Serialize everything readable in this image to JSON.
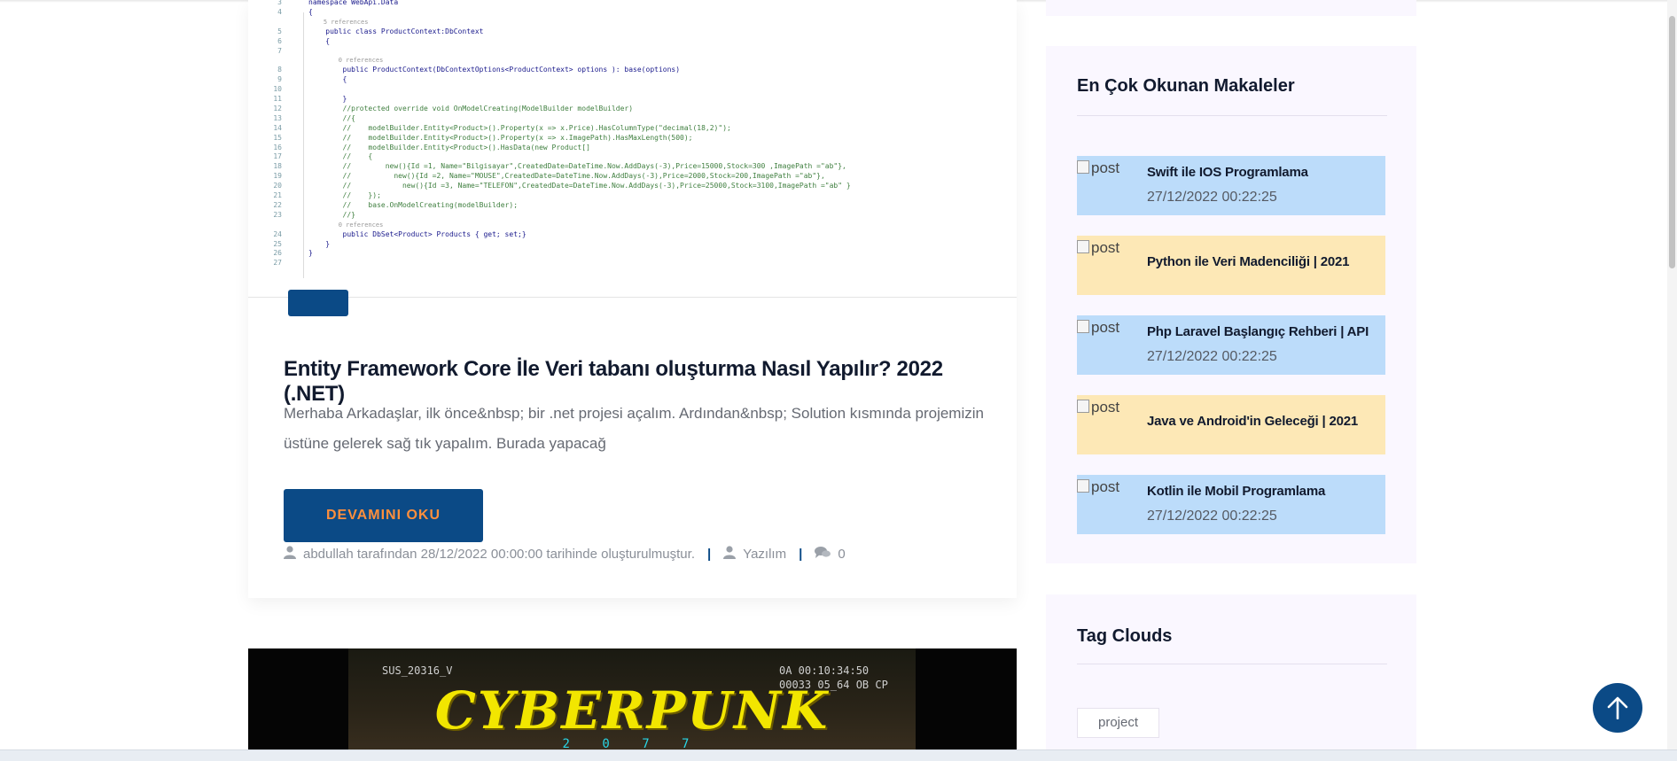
{
  "post": {
    "title": "Entity Framework Core İle Veri tabanı oluşturma Nasıl Yapılır? 2022 (.NET)",
    "excerpt": "Merhaba Arkadaşlar, ilk önce&nbsp; bir .net projesi açalım. Ardından&nbsp; Solution kısmında projemizin üstüne gelerek sağ tık yapalım. Burada yapacağ",
    "read_more_label": "DEVAMINI OKU",
    "author_text": "abdullah tarafından 28/12/2022 00:00:00 tarihinde oluşturulmuştur.",
    "category": "Yazılım",
    "comment_count": "0",
    "code_lines": [
      {
        "n": "3",
        "t": "namespace WebApi.Data"
      },
      {
        "n": "4",
        "t": "{"
      },
      {
        "n": "",
        "t": "    5 references",
        "ref": true
      },
      {
        "n": "5",
        "t": "    public class ProductContext:DbContext"
      },
      {
        "n": "6",
        "t": "    {"
      },
      {
        "n": "7",
        "t": ""
      },
      {
        "n": "",
        "t": "        0 references",
        "ref": true
      },
      {
        "n": "8",
        "t": "        public ProductContext(DbContextOptions<ProductContext> options ): base(options)"
      },
      {
        "n": "9",
        "t": "        {"
      },
      {
        "n": "10",
        "t": ""
      },
      {
        "n": "11",
        "t": "        }"
      },
      {
        "n": "12",
        "t": "        //protected override void OnModelCreating(ModelBuilder modelBuilder)",
        "cm": true
      },
      {
        "n": "13",
        "t": "        //{",
        "cm": true
      },
      {
        "n": "14",
        "t": "        //    modelBuilder.Entity<Product>().Property(x => x.Price).HasColumnType(\"decimal(18,2)\");",
        "cm": true
      },
      {
        "n": "15",
        "t": "        //    modelBuilder.Entity<Product>().Property(x => x.ImagePath).HasMaxLength(500);",
        "cm": true
      },
      {
        "n": "16",
        "t": "        //    modelBuilder.Entity<Product>().HasData(new Product[]",
        "cm": true
      },
      {
        "n": "17",
        "t": "        //    {",
        "cm": true
      },
      {
        "n": "18",
        "t": "        //        new(){Id =1, Name=\"Bilgisayar\",CreatedDate=DateTime.Now.AddDays(-3),Price=15000,Stock=300 ,ImagePath =\"ab\"},",
        "cm": true
      },
      {
        "n": "19",
        "t": "        //          new(){Id =2, Name=\"MOUSE\",CreatedDate=DateTime.Now.AddDays(-3),Price=2000,Stock=200,ImagePath =\"ab\"},",
        "cm": true
      },
      {
        "n": "20",
        "t": "        //            new(){Id =3, Name=\"TELEFON\",CreatedDate=DateTime.Now.AddDays(-3),Price=25000,Stock=3100,ImagePath =\"ab\" }",
        "cm": true
      },
      {
        "n": "21",
        "t": "        //    });",
        "cm": true
      },
      {
        "n": "22",
        "t": "        //    base.OnModelCreating(modelBuilder);",
        "cm": true
      },
      {
        "n": "23",
        "t": "        //}",
        "cm": true
      },
      {
        "n": "",
        "t": "        0 references",
        "ref": true
      },
      {
        "n": "24",
        "t": "        public DbSet<Product> Products { get; set;}"
      },
      {
        "n": "25",
        "t": "    }"
      },
      {
        "n": "26",
        "t": "}"
      },
      {
        "n": "27",
        "t": ""
      }
    ]
  },
  "next_post_image": {
    "logo_text": "CYBERPUNK",
    "year_text": "2 0 7 7",
    "top_left": "SUS_20316_V",
    "top_right_1": "0A      00:10:34:50",
    "top_right_2": "00033 05_64 OB CP"
  },
  "sidebar": {
    "popular_title": "En Çok Okunan Makaleler",
    "popular_items": [
      {
        "title": "Swift ile IOS Programlama",
        "date": "27/12/2022 00:22:25",
        "bg": "#bcdcfa",
        "img_alt": "post"
      },
      {
        "title": "Python ile Veri Madenciliği | 2021",
        "date": "",
        "bg": "#fde8b6",
        "img_alt": "post"
      },
      {
        "title": "Php Laravel Başlangıç Rehberi | API",
        "date": "27/12/2022 00:22:25",
        "bg": "#bcdcfa",
        "img_alt": "post"
      },
      {
        "title": "Java ve Android'in Geleceği | 2021",
        "date": "",
        "bg": "#fde8b6",
        "img_alt": "post"
      },
      {
        "title": "Kotlin ile Mobil Programlama",
        "date": "27/12/2022 00:22:25",
        "bg": "#bcdcfa",
        "img_alt": "post"
      }
    ],
    "tags_title": "Tag Clouds",
    "tags": [
      "project"
    ]
  },
  "colors": {
    "primary": "#0b4a86",
    "accent": "#ff8f3c",
    "sidebar_bg": "#faf7ff"
  }
}
